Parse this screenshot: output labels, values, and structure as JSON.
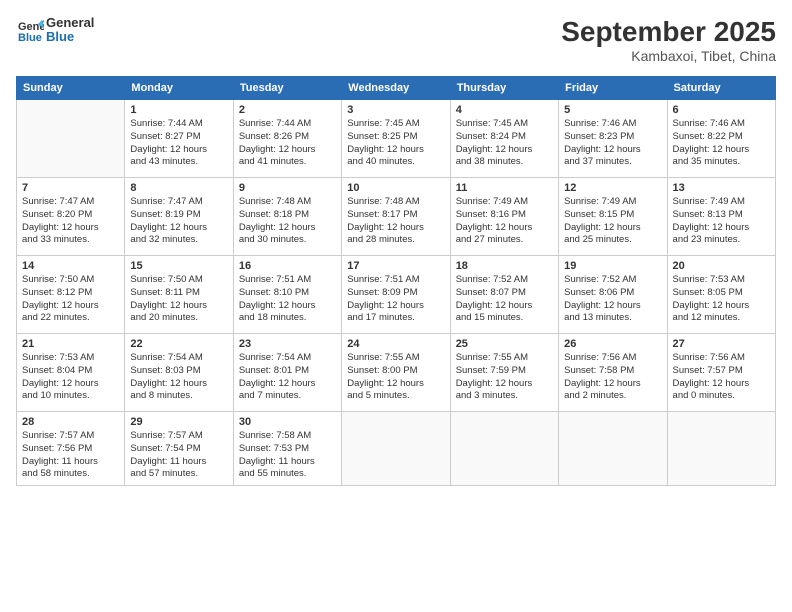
{
  "header": {
    "logo_line1": "General",
    "logo_line2": "Blue",
    "month": "September 2025",
    "location": "Kambaxoi, Tibet, China"
  },
  "weekdays": [
    "Sunday",
    "Monday",
    "Tuesday",
    "Wednesday",
    "Thursday",
    "Friday",
    "Saturday"
  ],
  "weeks": [
    [
      {
        "day": "",
        "info": ""
      },
      {
        "day": "1",
        "info": "Sunrise: 7:44 AM\nSunset: 8:27 PM\nDaylight: 12 hours\nand 43 minutes."
      },
      {
        "day": "2",
        "info": "Sunrise: 7:44 AM\nSunset: 8:26 PM\nDaylight: 12 hours\nand 41 minutes."
      },
      {
        "day": "3",
        "info": "Sunrise: 7:45 AM\nSunset: 8:25 PM\nDaylight: 12 hours\nand 40 minutes."
      },
      {
        "day": "4",
        "info": "Sunrise: 7:45 AM\nSunset: 8:24 PM\nDaylight: 12 hours\nand 38 minutes."
      },
      {
        "day": "5",
        "info": "Sunrise: 7:46 AM\nSunset: 8:23 PM\nDaylight: 12 hours\nand 37 minutes."
      },
      {
        "day": "6",
        "info": "Sunrise: 7:46 AM\nSunset: 8:22 PM\nDaylight: 12 hours\nand 35 minutes."
      }
    ],
    [
      {
        "day": "7",
        "info": "Sunrise: 7:47 AM\nSunset: 8:20 PM\nDaylight: 12 hours\nand 33 minutes."
      },
      {
        "day": "8",
        "info": "Sunrise: 7:47 AM\nSunset: 8:19 PM\nDaylight: 12 hours\nand 32 minutes."
      },
      {
        "day": "9",
        "info": "Sunrise: 7:48 AM\nSunset: 8:18 PM\nDaylight: 12 hours\nand 30 minutes."
      },
      {
        "day": "10",
        "info": "Sunrise: 7:48 AM\nSunset: 8:17 PM\nDaylight: 12 hours\nand 28 minutes."
      },
      {
        "day": "11",
        "info": "Sunrise: 7:49 AM\nSunset: 8:16 PM\nDaylight: 12 hours\nand 27 minutes."
      },
      {
        "day": "12",
        "info": "Sunrise: 7:49 AM\nSunset: 8:15 PM\nDaylight: 12 hours\nand 25 minutes."
      },
      {
        "day": "13",
        "info": "Sunrise: 7:49 AM\nSunset: 8:13 PM\nDaylight: 12 hours\nand 23 minutes."
      }
    ],
    [
      {
        "day": "14",
        "info": "Sunrise: 7:50 AM\nSunset: 8:12 PM\nDaylight: 12 hours\nand 22 minutes."
      },
      {
        "day": "15",
        "info": "Sunrise: 7:50 AM\nSunset: 8:11 PM\nDaylight: 12 hours\nand 20 minutes."
      },
      {
        "day": "16",
        "info": "Sunrise: 7:51 AM\nSunset: 8:10 PM\nDaylight: 12 hours\nand 18 minutes."
      },
      {
        "day": "17",
        "info": "Sunrise: 7:51 AM\nSunset: 8:09 PM\nDaylight: 12 hours\nand 17 minutes."
      },
      {
        "day": "18",
        "info": "Sunrise: 7:52 AM\nSunset: 8:07 PM\nDaylight: 12 hours\nand 15 minutes."
      },
      {
        "day": "19",
        "info": "Sunrise: 7:52 AM\nSunset: 8:06 PM\nDaylight: 12 hours\nand 13 minutes."
      },
      {
        "day": "20",
        "info": "Sunrise: 7:53 AM\nSunset: 8:05 PM\nDaylight: 12 hours\nand 12 minutes."
      }
    ],
    [
      {
        "day": "21",
        "info": "Sunrise: 7:53 AM\nSunset: 8:04 PM\nDaylight: 12 hours\nand 10 minutes."
      },
      {
        "day": "22",
        "info": "Sunrise: 7:54 AM\nSunset: 8:03 PM\nDaylight: 12 hours\nand 8 minutes."
      },
      {
        "day": "23",
        "info": "Sunrise: 7:54 AM\nSunset: 8:01 PM\nDaylight: 12 hours\nand 7 minutes."
      },
      {
        "day": "24",
        "info": "Sunrise: 7:55 AM\nSunset: 8:00 PM\nDaylight: 12 hours\nand 5 minutes."
      },
      {
        "day": "25",
        "info": "Sunrise: 7:55 AM\nSunset: 7:59 PM\nDaylight: 12 hours\nand 3 minutes."
      },
      {
        "day": "26",
        "info": "Sunrise: 7:56 AM\nSunset: 7:58 PM\nDaylight: 12 hours\nand 2 minutes."
      },
      {
        "day": "27",
        "info": "Sunrise: 7:56 AM\nSunset: 7:57 PM\nDaylight: 12 hours\nand 0 minutes."
      }
    ],
    [
      {
        "day": "28",
        "info": "Sunrise: 7:57 AM\nSunset: 7:56 PM\nDaylight: 11 hours\nand 58 minutes."
      },
      {
        "day": "29",
        "info": "Sunrise: 7:57 AM\nSunset: 7:54 PM\nDaylight: 11 hours\nand 57 minutes."
      },
      {
        "day": "30",
        "info": "Sunrise: 7:58 AM\nSunset: 7:53 PM\nDaylight: 11 hours\nand 55 minutes."
      },
      {
        "day": "",
        "info": ""
      },
      {
        "day": "",
        "info": ""
      },
      {
        "day": "",
        "info": ""
      },
      {
        "day": "",
        "info": ""
      }
    ]
  ]
}
